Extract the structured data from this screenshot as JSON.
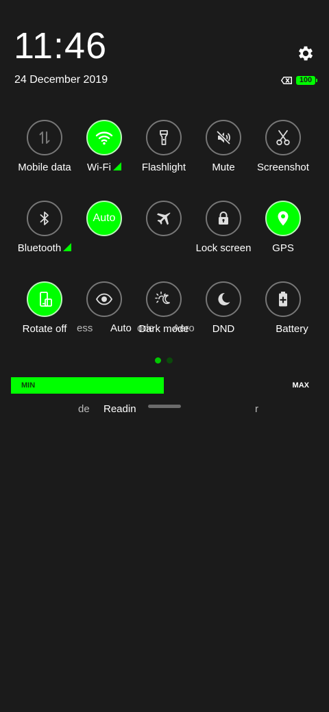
{
  "status": {
    "time": "11:46",
    "date": "24 December 2019",
    "battery_level": "100",
    "battery_color": "#00ff00"
  },
  "icons": {
    "settings": "gear-icon",
    "sim": "no-sim-icon",
    "battery": "battery-icon"
  },
  "tiles": {
    "row1": [
      {
        "label": "Mobile data",
        "icon": "mobile-data-icon",
        "active": false
      },
      {
        "label": "Wi-Fi",
        "icon": "wifi-icon",
        "active": true
      },
      {
        "label": "Flashlight",
        "icon": "flashlight-icon",
        "active": false
      },
      {
        "label": "Mute",
        "icon": "mute-icon",
        "active": false
      },
      {
        "label": "Screenshot",
        "icon": "scissors-icon",
        "active": false
      }
    ],
    "row2": [
      {
        "label": "Bluetooth",
        "icon": "bluetooth-icon",
        "active": false
      },
      {
        "label": "Auto",
        "icon": "auto-brightness-icon",
        "active": true,
        "label_visible": "Auto"
      },
      {
        "label": "",
        "icon": "airplane-icon",
        "active": false
      },
      {
        "label": "Lock screen",
        "icon": "lock-icon",
        "active": false
      },
      {
        "label": "GPS",
        "icon": "location-pin-icon",
        "active": true
      }
    ],
    "row3": [
      {
        "label": "Rotate off",
        "icon": "rotate-icon",
        "active": true
      },
      {
        "label": "",
        "icon": "eye-icon",
        "active": false
      },
      {
        "label": "Dark mode",
        "icon": "dark-mode-icon",
        "active": false
      },
      {
        "label": "DND",
        "icon": "moon-icon",
        "active": false
      },
      {
        "label": "Battery",
        "icon": "battery-saver-icon",
        "active": false
      }
    ],
    "overlap_fragments": {
      "row2_a": "ess",
      "row2_b": "Auto",
      "row2_c": "ode",
      "row2_d": "Aero",
      "row3_a": "de",
      "row3_b": "Readin",
      "row3_c": "r"
    }
  },
  "pager": {
    "pages": 2,
    "current": 1
  },
  "brightness": {
    "min_label": "MIN",
    "max_label": "MAX",
    "level_fraction": 0.5,
    "color": "#00ff00"
  },
  "accent_color": "#00ff00"
}
